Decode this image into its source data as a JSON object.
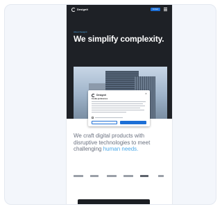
{
  "colors": {
    "hero_background": "#1e2126",
    "accent_blue": "#1d6fd6",
    "highlight_blue": "#4aa8e8",
    "body_text": "#6b7280"
  },
  "nav": {
    "brand": "Designit",
    "cta_label": "Contact",
    "menu_icon": "hamburger-icon"
  },
  "hero": {
    "eyebrow": "About Designit",
    "headline": "We simplify complexity."
  },
  "cookie_modal": {
    "brand": "Designit",
    "heading": "Cookie preferences",
    "close_icon": "close-icon"
  },
  "intro": {
    "text_before": "We craft digital products with disruptive technologies to meet challenging ",
    "text_highlight": "human needs."
  }
}
